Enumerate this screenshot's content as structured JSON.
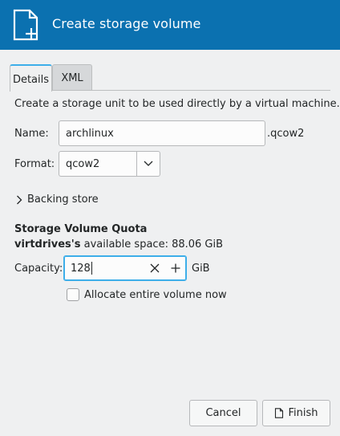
{
  "header": {
    "title": "Create storage volume",
    "icon": "new-document-icon"
  },
  "tabs": [
    {
      "label": "Details",
      "active": true
    },
    {
      "label": "XML",
      "active": false
    }
  ],
  "form": {
    "description": "Create a storage unit to be used directly by a virtual machine.",
    "name_label": "Name:",
    "name_value": "archlinux",
    "name_suffix": ".qcow2",
    "format_label": "Format:",
    "format_value": "qcow2",
    "backing_store_label": "Backing store"
  },
  "quota": {
    "title": "Storage Volume Quota",
    "pool_name": "virtdrives's",
    "available_text": " available space: 88.06 GiB",
    "capacity_label": "Capacity:",
    "capacity_value": "128",
    "capacity_unit": "GiB",
    "allocate_label": "Allocate entire volume now",
    "allocate_checked": false
  },
  "buttons": {
    "cancel": "Cancel",
    "finish": "Finish"
  },
  "colors": {
    "header_bg": "#0b71b0",
    "focus": "#3daee9",
    "window_bg": "#eff0f1"
  }
}
